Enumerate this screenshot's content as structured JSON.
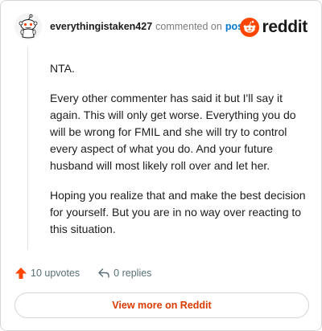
{
  "comment": {
    "username": "everythingistaken427",
    "action": "commented on",
    "post_link": "post",
    "paragraphs": [
      "NTA.",
      "Every other commenter has said it but I'll say it again. This will only get worse. Everything you do will be wrong for FMIL and she will try to control every aspect of what you do. And your future husband will most likely roll over and let her.",
      "Hoping you realize that and make the best decision for yourself. But you are in no way over reacting to this situation."
    ]
  },
  "brand": {
    "wordmark": "reddit",
    "color": "#ff4500"
  },
  "footer": {
    "upvotes_label": "10 upvotes",
    "replies_label": "0 replies",
    "upvote_color": "#ff4500"
  },
  "cta": {
    "label": "View more on Reddit",
    "color": "#d93a00"
  },
  "icons": [
    "snoo-avatar-icon",
    "reddit-logo-icon",
    "upvote-arrow-icon",
    "reply-icon"
  ]
}
